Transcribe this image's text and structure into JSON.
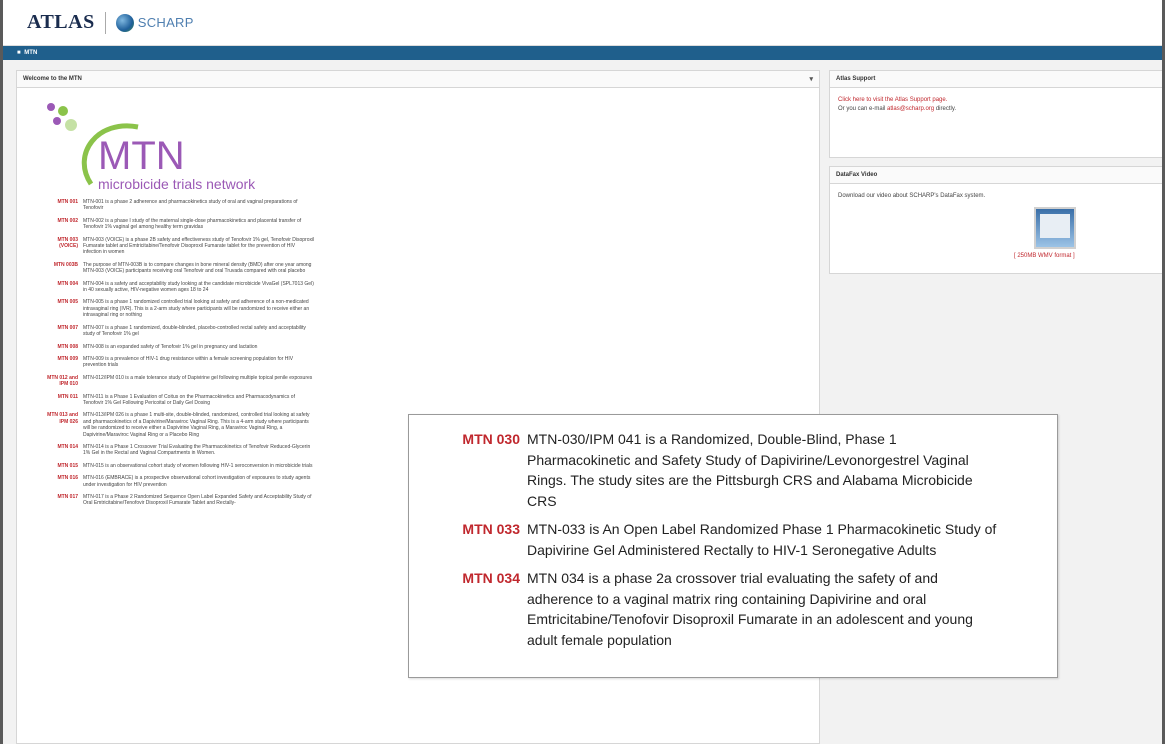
{
  "header": {
    "atlas_logo": "ATLAS",
    "scharp_logo": "SCHARP"
  },
  "nav": {
    "breadcrumb": "MTN"
  },
  "left_panel": {
    "title": "Welcome to the MTN",
    "logo_big": "MTN",
    "logo_sub": "microbicide trials network",
    "studies": [
      {
        "code": "MTN 001",
        "desc": "MTN-001 is a phase 2 adherence and pharmacokinetics study of oral and vaginal preparations of Tenofovir"
      },
      {
        "code": "MTN 002",
        "desc": "MTN-002 is a phase I study of the maternal single-dose pharmacokinetics and placental transfer of Tenofovir 1% vaginal gel among healthy term gravidas"
      },
      {
        "code": "MTN 003\n(VOICE)",
        "desc": "MTN-003 (VOICE) is a phase 2B safety and effectiveness study of Tenofovir 1% gel, Tenofovir Disoproxil Fumarate tablet and Emtricitabine/Tenofovir Disoproxil Fumarate tablet for the prevention of HIV infection in women"
      },
      {
        "code": "MTN 003B",
        "desc": "The purpose of MTN-003B is to compare changes in bone mineral density (BMD) after one year among MTN-003 (VOICE) participants receiving oral Tenofovir and oral Truvada compared with oral placebo"
      },
      {
        "code": "MTN 004",
        "desc": "MTN-004 is a safety and acceptability study looking at the candidate microbicide VivaGel (SPL7013 Gel) in 40 sexually active, HIV-negative women ages 18 to 24"
      },
      {
        "code": "MTN 005",
        "desc": "MTN-005 is a phase 1 randomized controlled trial looking at safety and adherence of a non-medicated intravaginal ring (IVR). This is a 2-arm study where participants will be randomized to receive either an intravaginal ring or nothing"
      },
      {
        "code": "MTN 007",
        "desc": "MTN-007 is a phase 1 randomized, double-blinded, placebo-controlled rectal safety and acceptability study of Tenofovir 1% gel"
      },
      {
        "code": "MTN 008",
        "desc": "MTN-008 is an expanded safety of Tenofovir 1% gel in pregnancy and lactation"
      },
      {
        "code": "MTN 009",
        "desc": "MTN-009 is a prevalence of HIV-1 drug resistance within a female screening population for HIV prevention trials"
      },
      {
        "code": "MTN 012 and\nIPM 010",
        "desc": "MTN-012/IPM 010 is a male tolerance study of Dapivirine gel following multiple topical penile exposures"
      },
      {
        "code": "MTN 011",
        "desc": "MTN-011 is a Phase 1 Evaluation of Coitus on the Pharmacokinetics and Pharmacodynamics of Tenofovir 1% Gel Following Pericoital or Daily Gel Dosing"
      },
      {
        "code": "MTN 013 and\nIPM 026",
        "desc": "MTN-013/IPM 026 is a phase 1 multi-site, double-blinded, randomized, controlled trial looking at safety and pharmacokinetics of a Dapivirine/Maraviroc Vaginal Ring. This is a 4-arm study where participants will be randomized to receive either a Dapivirine Vaginal Ring, a Maraviroc Vaginal Ring, a Dapivirine/Maraviroc Vaginal Ring or a Placebo Ring"
      },
      {
        "code": "MTN 014",
        "desc": "MTN-014 is a Phase 1 Crossover Trial Evaluating the Pharmacokinetics of Tenofovir Reduced-Glycerin 1% Gel in the Rectal and Vaginal Compartments in Women."
      },
      {
        "code": "MTN 015",
        "desc": "MTN-015 is an observational cohort study of women following HIV-1 seroconversion in microbicide trials"
      },
      {
        "code": "MTN 016",
        "desc": "MTN-016 (EMBRACE) is a prospective observational cohort investigation of exposures to study agents under investigation for HIV prevention"
      },
      {
        "code": "MTN 017",
        "desc": "MTN-017 is a Phase 2 Randomized Sequence Open Label Expanded Safety and Acceptability Study of Oral Emtricitabine/Tenofovir Disoproxil Fumarate Tablet and Rectally-"
      }
    ]
  },
  "support_panel": {
    "title": "Atlas Support",
    "link_text": "Click here to visit the Atlas Support page.",
    "email_prefix": "Or you can e-mail ",
    "email": "atlas@scharp.org",
    "email_suffix": " directly."
  },
  "video_panel": {
    "title": "DataFax Video",
    "text": "Download our video about SCHARP's DataFax system.",
    "link": "[ 250MB WMV format ]"
  },
  "callout": [
    {
      "code": "MTN 030",
      "desc": "MTN-030/IPM 041 is a Randomized, Double-Blind, Phase 1 Pharmacokinetic and Safety Study of Dapivirine/Levonorgestrel Vaginal Rings. The study sites are the Pittsburgh CRS and Alabama Microbicide CRS"
    },
    {
      "code": "MTN 033",
      "desc": "MTN-033 is An Open Label Randomized Phase 1 Pharmacokinetic Study of Dapivirine Gel Administered Rectally to HIV-1 Seronegative Adults"
    },
    {
      "code": "MTN 034",
      "desc": "MTN 034 is a phase 2a crossover trial evaluating the safety of and adherence to a vaginal matrix ring containing Dapivirine and oral Emtricitabine/Tenofovir Disoproxil Fumarate in an adolescent and young adult female population"
    }
  ],
  "colors": {
    "accent_red": "#c0272d",
    "nav_blue": "#1f5f8c",
    "mtn_purple": "#9b59b6",
    "mtn_green": "#8bc34a"
  }
}
